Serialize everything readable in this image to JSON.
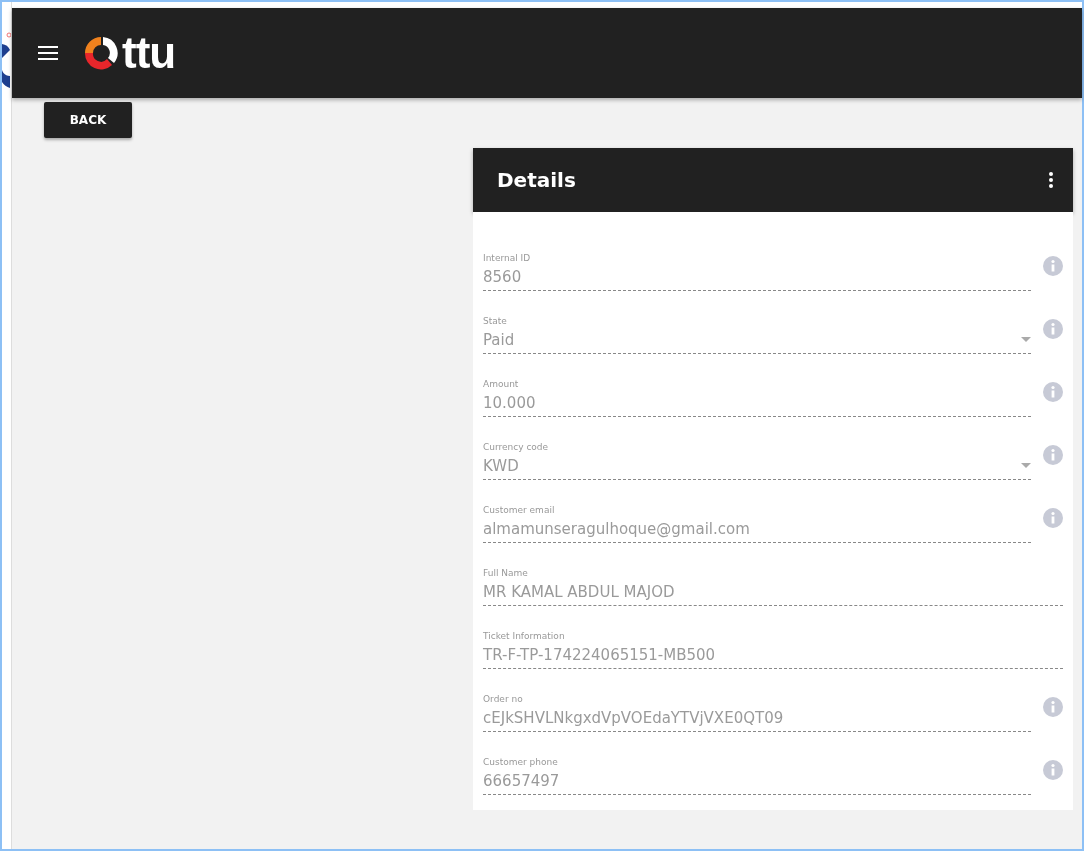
{
  "header": {
    "logo": "ttu"
  },
  "back_button": "BACK",
  "details": {
    "title": "Details",
    "fields": [
      {
        "label": "Internal ID",
        "value": "8560",
        "kind": "text",
        "info": true
      },
      {
        "label": "State",
        "value": "Paid",
        "kind": "select",
        "info": true
      },
      {
        "label": "Amount",
        "value": "10.000",
        "kind": "text",
        "info": true
      },
      {
        "label": "Currency code",
        "value": "KWD",
        "kind": "select",
        "info": true
      },
      {
        "label": "Customer email",
        "value": "almamunseragulhoque@gmail.com",
        "kind": "text",
        "info": true
      },
      {
        "label": "Full Name",
        "value": "MR KAMAL ABDUL MAJOD",
        "kind": "text",
        "info": false
      },
      {
        "label": "Ticket Information",
        "value": "TR-F-TP-174224065151-MB500",
        "kind": "text",
        "info": false
      },
      {
        "label": "Order no",
        "value": "cEJkSHVLNkgxdVpVOEdaYTVjVXE0QT09",
        "kind": "text",
        "info": true
      },
      {
        "label": "Customer phone",
        "value": "66657497",
        "kind": "text",
        "info": true
      }
    ]
  }
}
